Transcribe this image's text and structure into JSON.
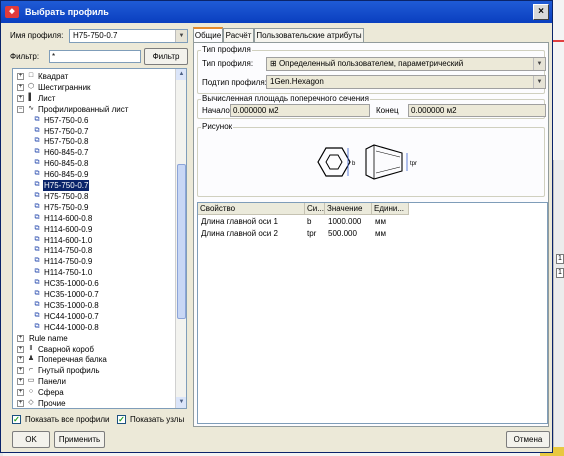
{
  "window": {
    "title": "Выбрать профиль",
    "close_glyph": "×"
  },
  "left": {
    "profile_name_label": "Имя профиля:",
    "profile_name_value": "H75-750-0.7",
    "filter_label": "Фильтр:",
    "filter_value": "*",
    "filter_button": "Фильтр",
    "tree": [
      {
        "label": "Квадрат",
        "level": 0,
        "expander": "+",
        "icon": "square-profile-icon",
        "glyph": "□"
      },
      {
        "label": "Шестигранник",
        "level": 0,
        "expander": "+",
        "icon": "hexagon-profile-icon",
        "glyph": "⬡"
      },
      {
        "label": "Лист",
        "level": 0,
        "expander": "+",
        "icon": "sheet-profile-icon",
        "glyph": "▌"
      },
      {
        "label": "Профилированный лист",
        "level": 0,
        "expander": "−",
        "icon": "corrugated-sheet-icon",
        "glyph": "∿"
      },
      {
        "label": "H57-750-0.6",
        "level": 1,
        "icon": "profile-item-icon",
        "glyph": "⧉"
      },
      {
        "label": "H57-750-0.7",
        "level": 1,
        "icon": "profile-item-icon",
        "glyph": "⧉"
      },
      {
        "label": "H57-750-0.8",
        "level": 1,
        "icon": "profile-item-icon",
        "glyph": "⧉"
      },
      {
        "label": "H60-845-0.7",
        "level": 1,
        "icon": "profile-item-icon",
        "glyph": "⧉"
      },
      {
        "label": "H60-845-0.8",
        "level": 1,
        "icon": "profile-item-icon",
        "glyph": "⧉"
      },
      {
        "label": "H60-845-0.9",
        "level": 1,
        "icon": "profile-item-icon",
        "glyph": "⧉"
      },
      {
        "label": "H75-750-0.7",
        "level": 1,
        "icon": "profile-item-icon",
        "glyph": "⧉",
        "selected": true
      },
      {
        "label": "H75-750-0.8",
        "level": 1,
        "icon": "profile-item-icon",
        "glyph": "⧉"
      },
      {
        "label": "H75-750-0.9",
        "level": 1,
        "icon": "profile-item-icon",
        "glyph": "⧉"
      },
      {
        "label": "H114-600-0.8",
        "level": 1,
        "icon": "profile-item-icon",
        "glyph": "⧉"
      },
      {
        "label": "H114-600-0.9",
        "level": 1,
        "icon": "profile-item-icon",
        "glyph": "⧉"
      },
      {
        "label": "H114-600-1.0",
        "level": 1,
        "icon": "profile-item-icon",
        "glyph": "⧉"
      },
      {
        "label": "H114-750-0.8",
        "level": 1,
        "icon": "profile-item-icon",
        "glyph": "⧉"
      },
      {
        "label": "H114-750-0.9",
        "level": 1,
        "icon": "profile-item-icon",
        "glyph": "⧉"
      },
      {
        "label": "H114-750-1.0",
        "level": 1,
        "icon": "profile-item-icon",
        "glyph": "⧉"
      },
      {
        "label": "HC35-1000-0.6",
        "level": 1,
        "icon": "profile-item-icon",
        "glyph": "⧉"
      },
      {
        "label": "HC35-1000-0.7",
        "level": 1,
        "icon": "profile-item-icon",
        "glyph": "⧉"
      },
      {
        "label": "HC35-1000-0.8",
        "level": 1,
        "icon": "profile-item-icon",
        "glyph": "⧉"
      },
      {
        "label": "HC44-1000-0.7",
        "level": 1,
        "icon": "profile-item-icon",
        "glyph": "⧉"
      },
      {
        "label": "HC44-1000-0.8",
        "level": 1,
        "icon": "profile-item-icon",
        "glyph": "⧉"
      },
      {
        "label": "Rule name",
        "level": 0,
        "expander": "+",
        "icon": "",
        "glyph": ""
      },
      {
        "label": "Сварной короб",
        "level": 0,
        "expander": "+",
        "icon": "welded-box-icon",
        "glyph": "Ⅱ"
      },
      {
        "label": "Поперечная балка",
        "level": 0,
        "expander": "+",
        "icon": "cross-beam-icon",
        "glyph": "♟"
      },
      {
        "label": "Гнутый профиль",
        "level": 0,
        "expander": "+",
        "icon": "bent-profile-icon",
        "glyph": "⌐"
      },
      {
        "label": "Панели",
        "level": 0,
        "expander": "+",
        "icon": "panels-icon",
        "glyph": "▭"
      },
      {
        "label": "Сфера",
        "level": 0,
        "expander": "+",
        "icon": "sphere-icon",
        "glyph": "○"
      },
      {
        "label": "Прочие",
        "level": 0,
        "expander": "+",
        "icon": "other-icon",
        "glyph": "◇"
      }
    ],
    "show_all_profiles": "Показать все профили",
    "show_nodes": "Показать узлы"
  },
  "tabs": [
    "Общие",
    "Расчёт",
    "Пользовательские атрибуты"
  ],
  "general": {
    "profile_type_group": "Тип профиля",
    "profile_type_label": "Тип профиля:",
    "profile_type_value": "Определенный пользователем, параметрический",
    "profile_subtype_label": "Подтип профиля:",
    "profile_subtype_value": "1Gen.Hexagon",
    "area_group": "Вычисленная площадь поперечного сечения",
    "start_label": "Начало",
    "start_value": "0.000000 м2",
    "end_label": "Конец",
    "end_value": "0.000000 м2",
    "picture_group": "Рисунок",
    "fig_label_b": "b",
    "fig_label_tpr": "tpr"
  },
  "grid": {
    "headers": [
      "Свойство",
      "Си...",
      "Значение",
      "Едини..."
    ],
    "rows": [
      [
        "Длина главной оси 1",
        "b",
        "1000.000",
        "мм"
      ],
      [
        "Длина главной оси 2",
        "tpr",
        "500.000",
        "мм"
      ]
    ]
  },
  "buttons": {
    "ok": "OK",
    "apply": "Применить",
    "cancel": "Отмена"
  },
  "background": {
    "field1": "1",
    "field2": "1"
  }
}
